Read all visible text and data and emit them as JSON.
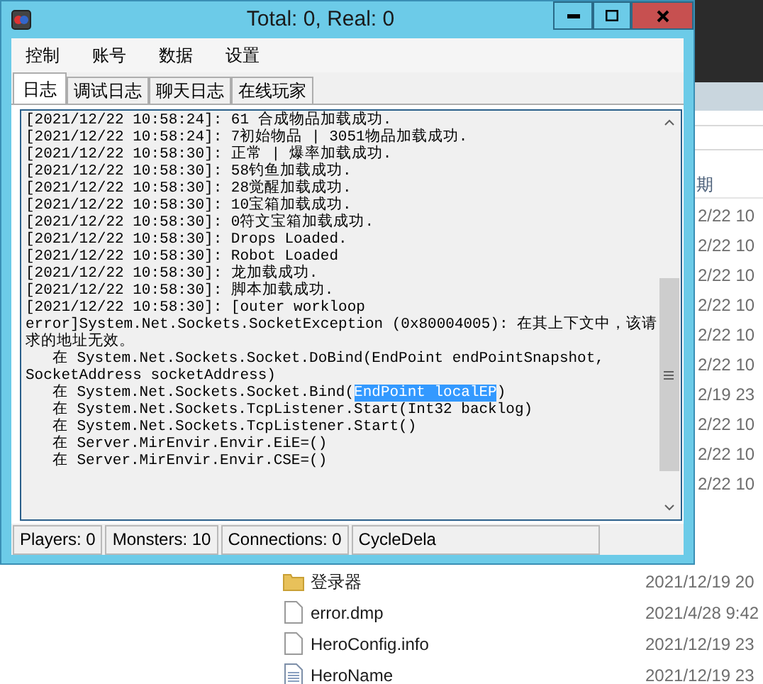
{
  "window": {
    "title": "Total: 0, Real: 0"
  },
  "menu": [
    "控制",
    "账号",
    "数据",
    "设置"
  ],
  "tabs": [
    {
      "label": "日志",
      "selected": true
    },
    {
      "label": "调试日志",
      "selected": false
    },
    {
      "label": "聊天日志",
      "selected": false
    },
    {
      "label": "在线玩家",
      "selected": false
    }
  ],
  "log_lines": [
    {
      "text": "[2021/12/22 10:58:24]: 61 合成物品加载成功."
    },
    {
      "text": "[2021/12/22 10:58:24]: 7初始物品 | 3051物品加载成功."
    },
    {
      "text": "[2021/12/22 10:58:30]: 正常 | 爆率加载成功."
    },
    {
      "text": "[2021/12/22 10:58:30]: 58钓鱼加载成功."
    },
    {
      "text": "[2021/12/22 10:58:30]: 28觉醒加载成功."
    },
    {
      "text": "[2021/12/22 10:58:30]: 10宝箱加载成功."
    },
    {
      "text": "[2021/12/22 10:58:30]: 0符文宝箱加载成功."
    },
    {
      "text": "[2021/12/22 10:58:30]: Drops Loaded."
    },
    {
      "text": "[2021/12/22 10:58:30]: Robot Loaded"
    },
    {
      "text": "[2021/12/22 10:58:30]: 龙加载成功."
    },
    {
      "text": "[2021/12/22 10:58:30]: 脚本加载成功."
    },
    {
      "text": "[2021/12/22 10:58:30]: [outer workloop"
    },
    {
      "text": "error]System.Net.Sockets.SocketException (0x80004005): 在其上下文中，该请"
    },
    {
      "text": "求的地址无效。"
    },
    {
      "text": "   在 System.Net.Sockets.Socket.DoBind(EndPoint endPointSnapshot,"
    },
    {
      "text": "SocketAddress socketAddress)"
    },
    {
      "text": "   在 System.Net.Sockets.Socket.Bind(",
      "selected_text": "EndPoint localEP",
      "after": ")"
    },
    {
      "text": "   在 System.Net.Sockets.TcpListener.Start(Int32 backlog)"
    },
    {
      "text": "   在 System.Net.Sockets.TcpListener.Start()"
    },
    {
      "text": "   在 Server.MirEnvir.Envir.EiE=()"
    },
    {
      "text": "   在 Server.MirEnvir.Envir.CSE=()"
    }
  ],
  "status_bar": [
    "Players: 0",
    "Monsters: 10",
    "Connections: 0",
    "CycleDela"
  ],
  "background_window": {
    "column_header": "期",
    "column_cells": [
      "2/22 10",
      "2/22 10",
      "2/22 10",
      "2/22 10",
      "2/22 10",
      "2/22 10",
      "2/19 23",
      "2/22 10",
      "2/22 10",
      "2/22 10"
    ],
    "files": [
      {
        "kind": "folder",
        "name": "登录器",
        "date": "2021/12/19 20"
      },
      {
        "kind": "file",
        "name": "error.dmp",
        "date": "2021/4/28 9:42"
      },
      {
        "kind": "file",
        "name": "HeroConfig.info",
        "date": "2021/12/19 23"
      },
      {
        "kind": "text",
        "name": "HeroName",
        "date": "2021/12/19 23"
      }
    ]
  }
}
